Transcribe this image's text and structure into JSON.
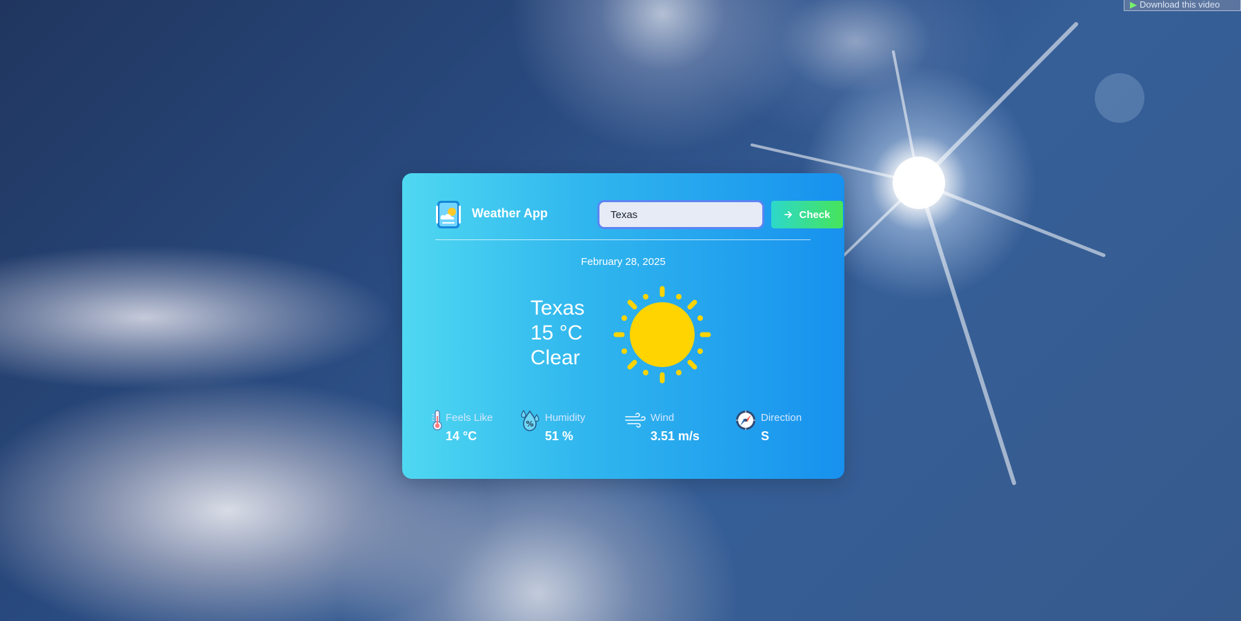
{
  "browser_overlay": {
    "download_label": "Download this video"
  },
  "app": {
    "title": "Weather App",
    "logo_icon": "weather-app-icon"
  },
  "search": {
    "value": "Texas",
    "placeholder": "",
    "button_label": "Check",
    "button_icon": "arrow-right-icon"
  },
  "weather": {
    "date": "February 28, 2025",
    "city": "Texas",
    "temperature": "15 °C",
    "condition": "Clear",
    "icon": "sun-icon"
  },
  "stats": [
    {
      "label": "Feels Like",
      "value": "14 °C",
      "icon": "thermometer-icon"
    },
    {
      "label": "Humidity",
      "value": "51 %",
      "icon": "humidity-icon"
    },
    {
      "label": "Wind",
      "value": "3.51 m/s",
      "icon": "wind-icon"
    },
    {
      "label": "Direction",
      "value": "S",
      "icon": "compass-icon"
    }
  ],
  "colors": {
    "card_gradient_start": "#4fd8f1",
    "card_gradient_end": "#1791ee",
    "check_button_start": "#2dd8ca",
    "check_button_end": "#46e45a",
    "sun_yellow": "#ffd400"
  }
}
